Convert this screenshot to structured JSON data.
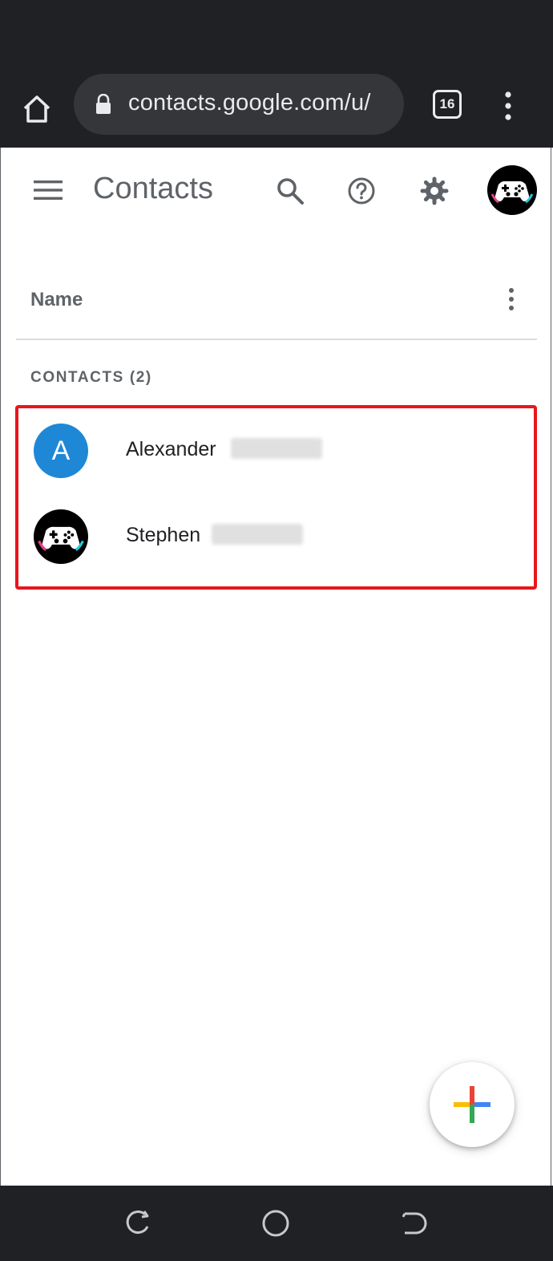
{
  "browser": {
    "url": "contacts.google.com/u/",
    "tab_count": "16"
  },
  "header": {
    "title": "Contacts"
  },
  "list": {
    "sort_label": "Name",
    "section_label": "CONTACTS (2)",
    "contacts": [
      {
        "name": "Alexander",
        "avatar_letter": "A",
        "avatar_color": "#1e88d6"
      },
      {
        "name": "Stephen",
        "avatar_type": "gamepad-image"
      }
    ]
  },
  "colors": {
    "highlight": "#e8161b",
    "browser_chrome": "#202124",
    "fab_blue": "#4285f4",
    "fab_red": "#ea4335",
    "fab_yellow": "#fbbc04",
    "fab_green": "#34a853"
  }
}
